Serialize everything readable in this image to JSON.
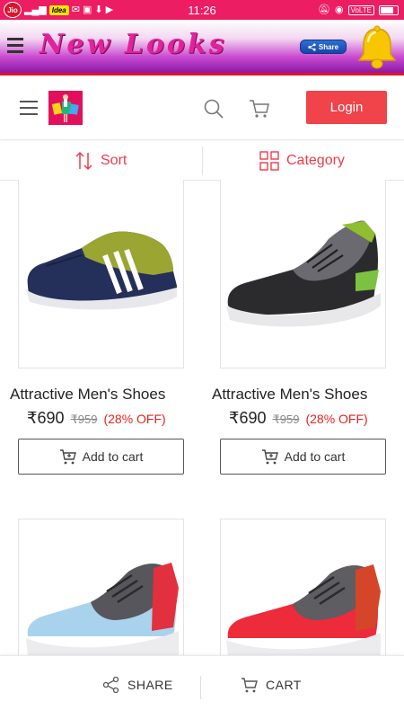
{
  "status_bar": {
    "carrier1": "Jio",
    "carrier2": "Idea",
    "time": "11:26",
    "volte": "VoLTE"
  },
  "app_header": {
    "brand": "New Looks",
    "share_label": "Share",
    "brand_color": "#e2229a"
  },
  "nav": {
    "login_label": "Login",
    "login_color": "#f0434a"
  },
  "filters": {
    "sort_label": "Sort",
    "category_label": "Category",
    "accent": "#ef3b4a"
  },
  "products": [
    {
      "title": "Attractive Men's Shoes",
      "price": "₹690",
      "mrp": "₹959",
      "discount": "(28% OFF)",
      "cart_label": "Add to cart",
      "image": "navy-lime-sneaker"
    },
    {
      "title": "Attractive Men's Shoes",
      "price": "₹690",
      "mrp": "₹959",
      "discount": "(28% OFF)",
      "cart_label": "Add to cart",
      "image": "grey-black-green-sneaker"
    },
    {
      "title": "",
      "price": "",
      "mrp": "",
      "discount": "",
      "cart_label": "",
      "image": "skyblue-red-sneaker"
    },
    {
      "title": "",
      "price": "",
      "mrp": "",
      "discount": "",
      "cart_label": "",
      "image": "red-grey-sneaker"
    }
  ],
  "bottom_bar": {
    "share_label": "SHARE",
    "cart_label": "CART"
  }
}
